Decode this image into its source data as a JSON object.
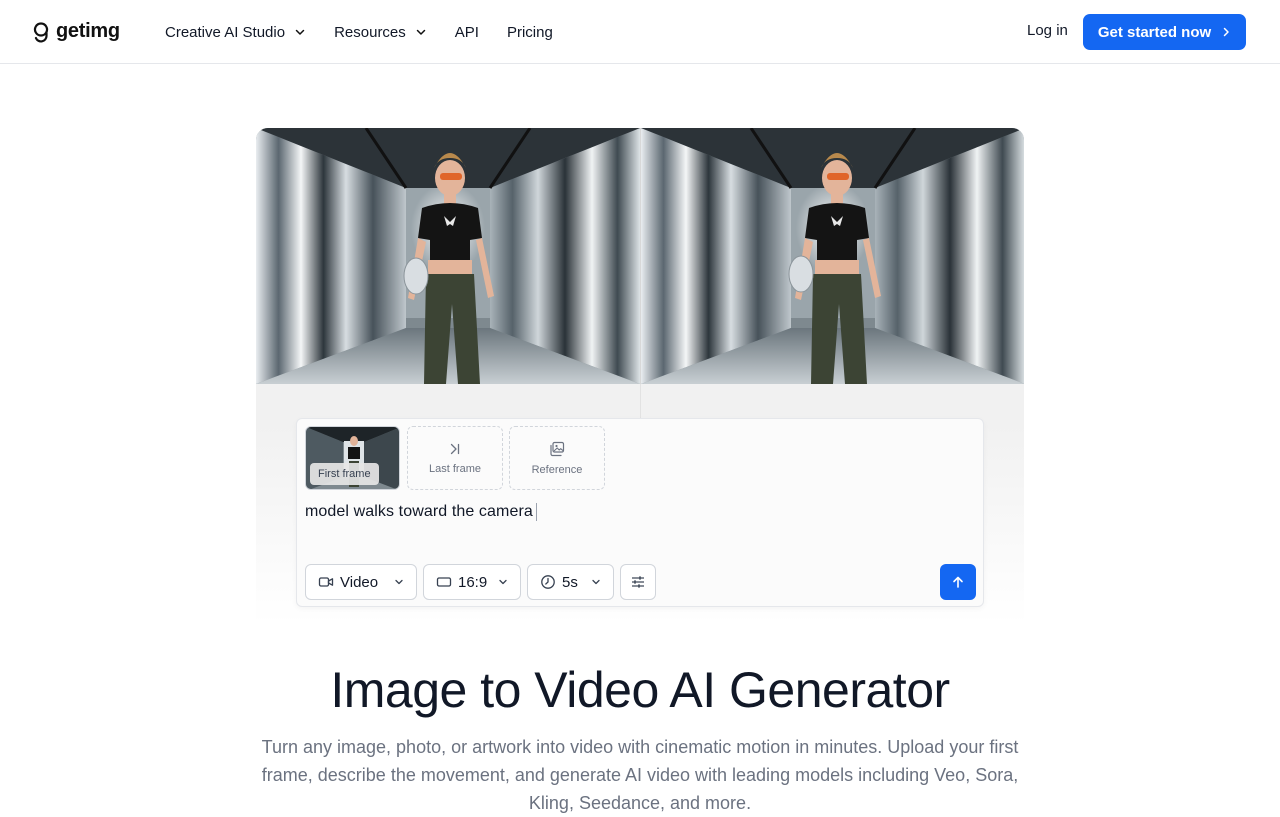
{
  "nav": {
    "logo_text": "getimg",
    "links": [
      {
        "label": "Creative AI Studio",
        "has_dropdown": true
      },
      {
        "label": "Resources",
        "has_dropdown": true
      },
      {
        "label": "API",
        "has_dropdown": false
      },
      {
        "label": "Pricing",
        "has_dropdown": false
      }
    ],
    "login_label": "Log in",
    "cta_label": "Get started now"
  },
  "composer": {
    "first_frame_label": "First frame",
    "last_frame_label": "Last frame",
    "reference_label": "Reference",
    "prompt_text": "model walks toward the camera",
    "mode_label": "Video",
    "aspect_ratio_label": "16:9",
    "duration_label": "5s"
  },
  "headline": "Image to Video AI Generator",
  "subheadline": "Turn any image, photo, or artwork into video with cinematic motion in minutes. Upload your first frame, describe the movement, and generate AI video with leading models including Veo, Sora, Kling, Seedance, and more.",
  "colors": {
    "accent": "#1467f2",
    "text": "#111827",
    "muted": "#6b7280",
    "border": "#e5e7eb"
  }
}
